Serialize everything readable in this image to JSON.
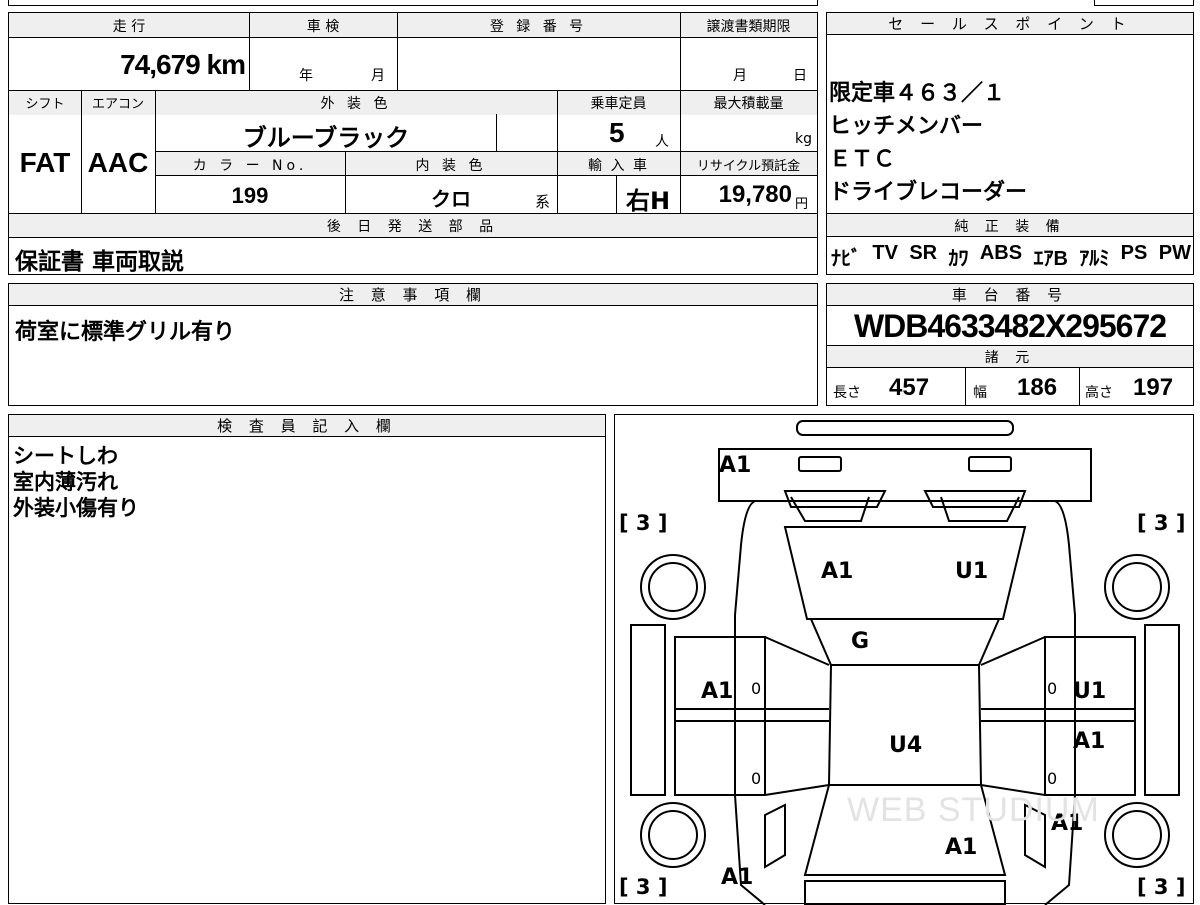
{
  "top": {
    "mileage_label": "走 行",
    "mileage": "74,679 km",
    "inspection_label": "車 検",
    "inspection_year": "年",
    "inspection_month": "月",
    "reg_label": "登 録 番 号",
    "transfer_label": "譲渡書類期限",
    "transfer_month": "月",
    "transfer_day": "日",
    "shift_label": "シフト",
    "shift": "FAT",
    "ac_label": "エアコン",
    "ac": "AAC",
    "ext_color_label": "外 装 色",
    "ext_color": "ブルーブラック",
    "capacity_label": "乗車定員",
    "capacity": "5",
    "capacity_unit": "人",
    "maxload_label": "最大積載量",
    "maxload_unit": "kg",
    "color_no_label": "カ ラ ー No.",
    "color_no": "199",
    "int_color_label": "内 装 色",
    "int_color": "クロ",
    "int_color_suffix": "系",
    "import_label": "輸 入 車",
    "import_value": "右H",
    "recycle_label": "リサイクル預託金",
    "recycle": "19,780",
    "recycle_unit": "円",
    "later_parts_label": "後 日 発 送 部 品",
    "later_parts": "保証書 車両取説"
  },
  "sales": {
    "label": "セ ー ル ス ポ イ ン ト",
    "points": [
      "限定車４６３／１",
      "ヒッチメンバー",
      "ＥＴＣ",
      "ドライブレコーダー"
    ],
    "equip_label": "純 正 装 備",
    "equipment": [
      "ﾅﾋﾞ",
      "TV",
      "SR",
      "ｶﾜ",
      "ABS",
      "ｴｱB",
      "ｱﾙﾐ",
      "PS",
      "PW"
    ]
  },
  "notes": {
    "label": "注 意 事 項 欄",
    "text": "荷室に標準グリル有り"
  },
  "chassis": {
    "label": "車 台 番 号",
    "number": "WDB4633482X295672",
    "spec_label": "諸 元",
    "length_label": "長さ",
    "length": "457",
    "width_label": "幅",
    "width": "186",
    "height_label": "高さ",
    "height": "197"
  },
  "inspector": {
    "label": "検 査 員 記 入 欄",
    "lines": [
      "シートしわ",
      "室内薄汚れ",
      "外装小傷有り"
    ]
  },
  "diagram": {
    "tire_marks": [
      "[ 3 ]",
      "[ 3 ]",
      "[ 3 ]",
      "[ 3 ]"
    ],
    "marks": {
      "front_bumper": "A1",
      "hood_left": "A1",
      "hood_right": "U1",
      "windshield": "G",
      "left_front_door": "A1",
      "right_front_door": "U1",
      "roof": "U4",
      "right_rear_door": "A1",
      "right_rear_fender": "A1",
      "rear_glass": "A1",
      "left_rear": "A1",
      "zero": "0"
    },
    "watermark": "WEB STUDIUM"
  }
}
